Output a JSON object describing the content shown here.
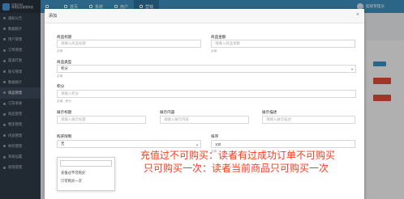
{
  "brand": {
    "line1": "分享CMS",
    "line2": "商城后台管理系统"
  },
  "sidebar": {
    "items": [
      {
        "label": "通知公告"
      },
      {
        "label": "数据统计"
      },
      {
        "label": "用户管理"
      },
      {
        "label": "订单管理"
      },
      {
        "label": "渠道打款"
      },
      {
        "label": "账号管理"
      },
      {
        "label": "数据统计"
      },
      {
        "label": "商品管理"
      },
      {
        "label": "订货系统"
      },
      {
        "label": "商品管理"
      },
      {
        "label": "物流管理"
      },
      {
        "label": "内容管理"
      },
      {
        "label": "财务管理"
      },
      {
        "label": "系统设置"
      },
      {
        "label": "权限管理"
      }
    ]
  },
  "topnav": {
    "items": [
      {
        "label": "首页"
      },
      {
        "label": "系统"
      },
      {
        "label": "用户"
      },
      {
        "label": "营销"
      }
    ]
  },
  "user": {
    "name": "超级管理员"
  },
  "modal": {
    "title": "添加",
    "fields": {
      "product_title": {
        "label": "商品标题",
        "placeholder": "请输入商品标题",
        "hint": "必填"
      },
      "product_price": {
        "label": "商品金额",
        "placeholder": "请输入商品金额",
        "hint": "必填"
      },
      "product_type": {
        "label": "商品类型",
        "value": "积分",
        "hint": "必填"
      },
      "points": {
        "label": "积分",
        "placeholder": "请输入积分",
        "hint": "必填，积分"
      },
      "display_title": {
        "label": "展示标题",
        "placeholder": "请输入展示标题"
      },
      "display_content": {
        "label": "展示内容",
        "placeholder": "请输入展示内容"
      },
      "display_desc": {
        "label": "展示描述",
        "placeholder": "请输入展示描述"
      },
      "limit_purchase": {
        "label": "购买限制",
        "value": "无",
        "options": [
          "充值过不可购买",
          "只可购买一次"
        ]
      },
      "sort": {
        "label": "排序",
        "value": "100",
        "hint": "必填"
      }
    }
  },
  "annotation": {
    "line1": "充值过不可购买：读者有过成功订单不可购买",
    "line2": "只可购买一次：读者当前商品只可购买一次"
  },
  "colors": {
    "topbar": "#3c8dbc",
    "sidebar": "#2f3a46",
    "annotation": "#ff3a1f"
  }
}
